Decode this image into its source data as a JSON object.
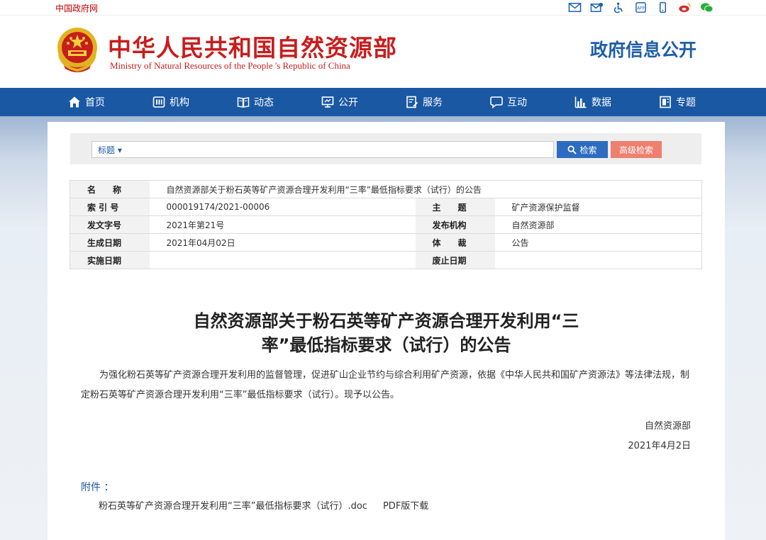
{
  "topbar": {
    "gov_link": "中国政府网",
    "icons": [
      "mail-icon",
      "feedback-icon",
      "accessibility-icon",
      "app-icon",
      "mobile-icon",
      "weibo-icon",
      "wechat-icon"
    ]
  },
  "header": {
    "ministry_cn": "中华人民共和国自然资源部",
    "ministry_en": "Ministry of Natural Resources of the People 's Republic of China",
    "gov_info": "政府信息公开"
  },
  "nav": {
    "items": [
      {
        "label": "首页",
        "icon": "home-icon"
      },
      {
        "label": "机构",
        "icon": "institution-icon"
      },
      {
        "label": "动态",
        "icon": "news-icon"
      },
      {
        "label": "公开",
        "icon": "disclosure-icon"
      },
      {
        "label": "服务",
        "icon": "service-icon"
      },
      {
        "label": "互动",
        "icon": "interaction-icon"
      },
      {
        "label": "数据",
        "icon": "data-icon"
      },
      {
        "label": "专题",
        "icon": "topic-icon"
      }
    ]
  },
  "search": {
    "type_label": "标题 ▾",
    "value": "",
    "search_button": "检索",
    "advanced_button": "高级检索"
  },
  "info": {
    "name_label": "名　　称",
    "name_value": "自然资源部关于粉石英等矿产资源合理开发利用“三率”最低指标要求（试行）的公告",
    "index_label": "索 引 号",
    "index_value": "000019174/2021-00006",
    "subject_label": "主　　题",
    "subject_value": "矿产资源保护监督",
    "doc_no_label": "发文字号",
    "doc_no_value": "2021年第21号",
    "issuer_label": "发布机构",
    "issuer_value": "自然资源部",
    "created_label": "生成日期",
    "created_value": "2021年04月02日",
    "genre_label": "体　　裁",
    "genre_value": "公告",
    "effective_label": "实施日期",
    "effective_value": "",
    "expire_label": "废止日期",
    "expire_value": ""
  },
  "article": {
    "title_line1": "自然资源部关于粉石英等矿产资源合理开发利用“三",
    "title_line2": "率”最低指标要求（试行）的公告",
    "body": "为强化粉石英等矿产资源合理开发利用的监督管理，促进矿山企业节约与综合利用矿产资源，依据《中华人民共和国矿产资源法》等法律法规，制定粉石英等矿产资源合理开发利用“三率”最低指标要求（试行）。现予以公告。",
    "sign_org": "自然资源部",
    "sign_date": "2021年4月2日",
    "attachment_label": "附件 ：",
    "attachment_file": "粉石英等矿产资源合理开发利用“三率”最低指标要求（试行）.doc",
    "attachment_pdf": "PDF版下载"
  },
  "colors": {
    "brand_red": "#c81d1d",
    "nav_blue": "#1a58a3",
    "search_blue": "#2d6cc0",
    "advanced_red": "#ef7f6f"
  }
}
